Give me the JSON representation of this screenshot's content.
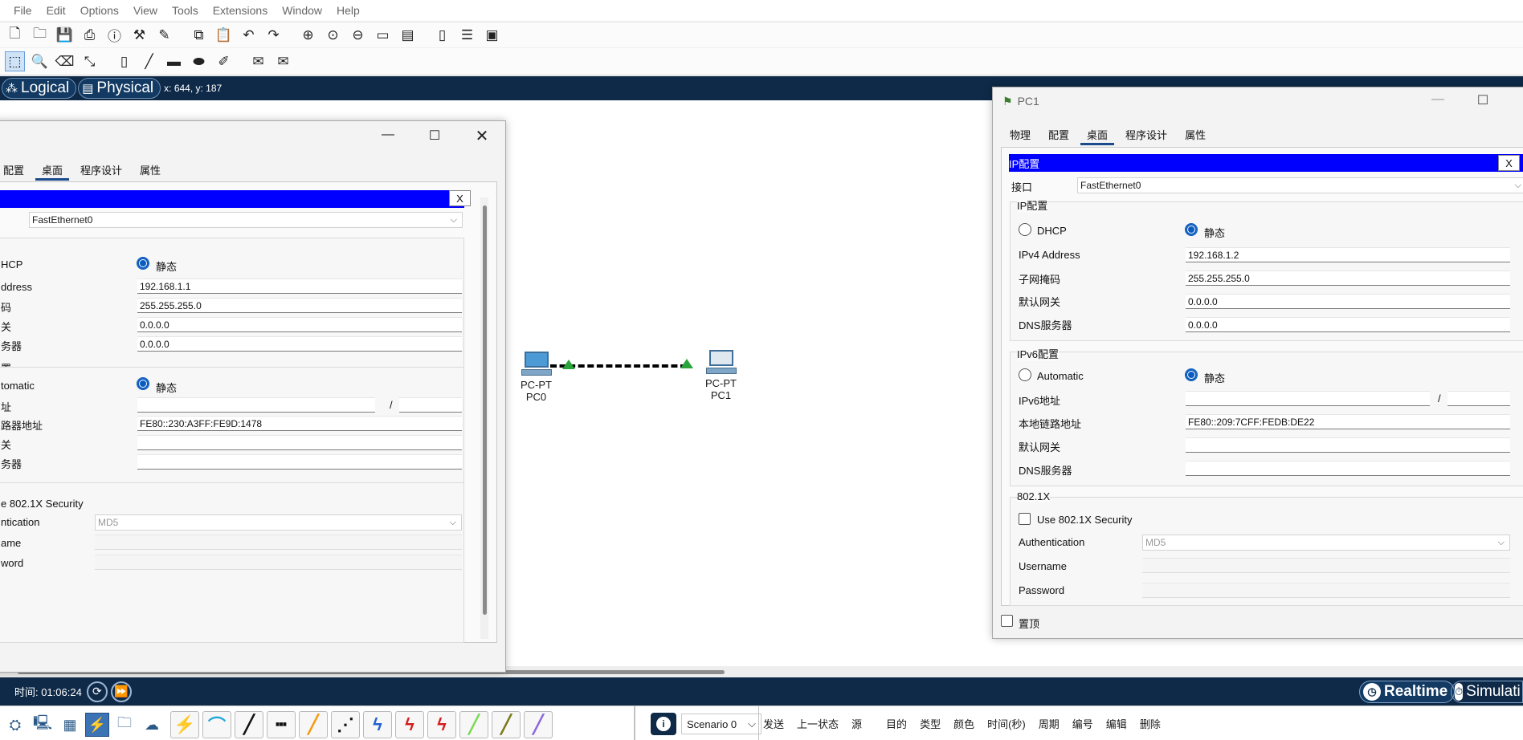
{
  "menu": [
    "File",
    "Edit",
    "Options",
    "View",
    "Tools",
    "Extensions",
    "Window",
    "Help"
  ],
  "toolbar1_icons": [
    "new-icon",
    "open-icon",
    "save-icon",
    "print-icon",
    "info-icon",
    "wizard-icon",
    "activity-icon",
    "copy-icon",
    "paste-icon",
    "undo-icon",
    "redo-icon",
    "zoom-in-icon",
    "zoom-reset-icon",
    "zoom-out-icon",
    "drawing-palette-icon",
    "custom-devices-icon",
    "notes-icon",
    "viewport-icon",
    "screenshot-icon"
  ],
  "toolbar2_icons": [
    "select-icon",
    "inspect-icon",
    "delete-icon",
    "resize-icon",
    "note-icon",
    "line-icon",
    "rectangle-icon",
    "ellipse-icon",
    "freeform-icon",
    "add-pdu-icon",
    "add-complex-pdu-icon"
  ],
  "workspace": {
    "logical": "Logical",
    "physical": "Physical",
    "coords": "x: 644, y: 187"
  },
  "devices": [
    {
      "type": "PC-PT",
      "name": "PC0"
    },
    {
      "type": "PC-PT",
      "name": "PC1"
    }
  ],
  "timebar": {
    "time": "时间: 01:06:24",
    "realtime": "Realtime",
    "simulation": "Simulati"
  },
  "bottom": {
    "scenario": "Scenario 0",
    "event_headers": [
      "发送",
      "上一状态",
      "源",
      "目的",
      "类型",
      "颜色",
      "时间(秒)",
      "周期",
      "编号",
      "编辑",
      "删除"
    ]
  },
  "pc0": {
    "tabs": [
      "配置",
      "桌面",
      "程序设计",
      "属性"
    ],
    "interface": "FastEthernet0",
    "dhcp": "HCP",
    "static": "静态",
    "ipv4_label": "ddress",
    "ipv4": "192.168.1.1",
    "mask_label": "码",
    "mask": "255.255.255.0",
    "gw_label": "关",
    "gw": "0.0.0.0",
    "dns_label": "务器",
    "dns": "0.0.0.0",
    "ipv6_group": "置",
    "automatic": "tomatic",
    "static6": "静态",
    "ipv6_label": "址",
    "ipv6_sep": "/",
    "ll_label": "路器地址",
    "ll": "FE80::230:A3FF:FE9D:1478",
    "gw6_label": "关",
    "dns6_label": "务器",
    "sec": "e 802.1X Security",
    "auth_label": "ntication",
    "auth": "MD5",
    "user_label": "ame",
    "pass_label": "word",
    "x": "X"
  },
  "pc1": {
    "title": "PC1",
    "tabs": [
      "物理",
      "配置",
      "桌面",
      "程序设计",
      "属性"
    ],
    "panel_title": "IP配置",
    "x": "X",
    "interface_label": "接口",
    "interface": "FastEthernet0",
    "ipcfg_group": "IP配置",
    "dhcp": "DHCP",
    "static": "静态",
    "ipv4_label": "IPv4 Address",
    "ipv4": "192.168.1.2",
    "mask_label": "子网掩码",
    "mask": "255.255.255.0",
    "gw_label": "默认网关",
    "gw": "0.0.0.0",
    "dns_label": "DNS服务器",
    "dns": "0.0.0.0",
    "ipv6_group": "IPv6配置",
    "automatic": "Automatic",
    "static6": "静态",
    "ipv6_label": "IPv6地址",
    "ipv6_sep": "/",
    "ll_label": "本地链路地址",
    "ll": "FE80::209:7CFF:FEDB:DE22",
    "gw6_label": "默认网关",
    "dns6_label": "DNS服务器",
    "dot1x_group": "802.1X",
    "sec": "Use 802.1X Security",
    "auth_label": "Authentication",
    "auth": "MD5",
    "user_label": "Username",
    "pass_label": "Password",
    "top_label": "置顶"
  }
}
